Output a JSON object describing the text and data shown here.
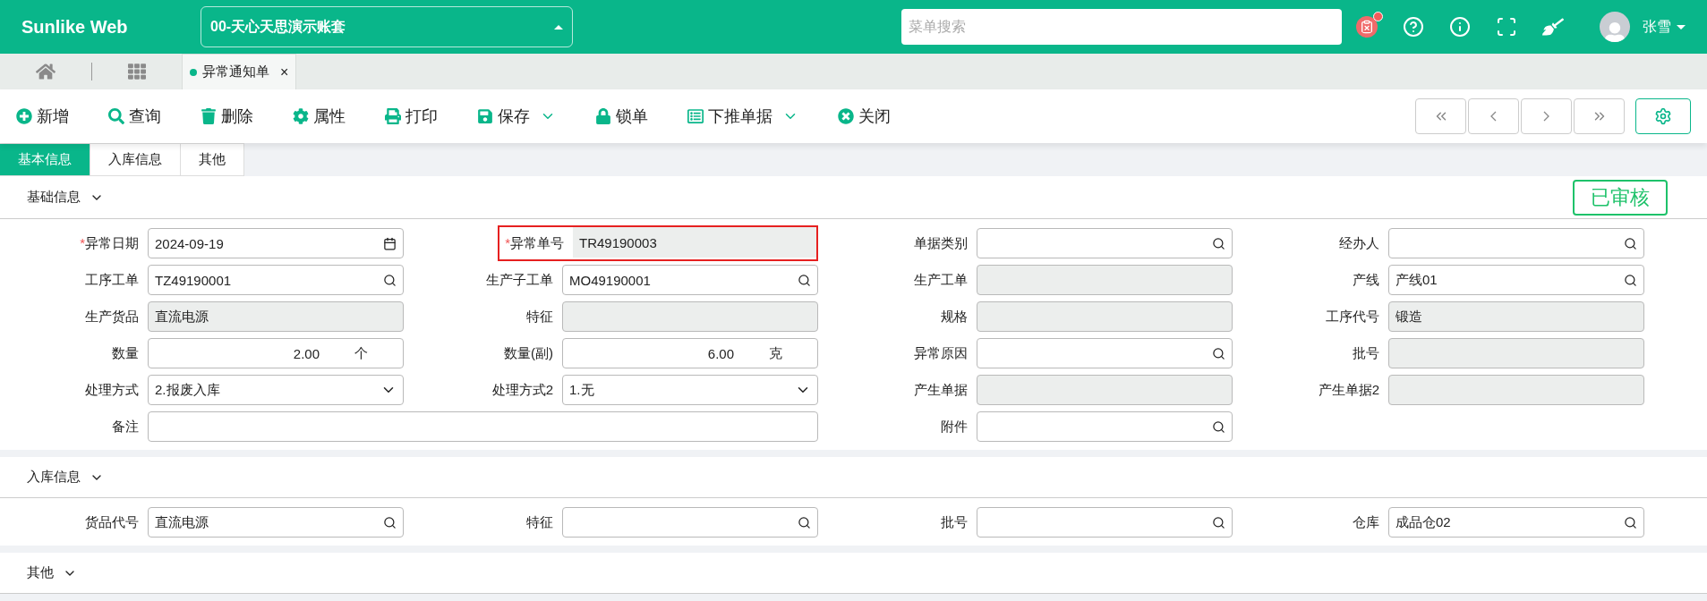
{
  "header": {
    "logo": "Sunlike Web",
    "account": "00-天心天思演示账套",
    "search": {
      "placeholder": "菜单搜索"
    },
    "notification_badge": true,
    "user": "张雪"
  },
  "open_tabs": [
    {
      "label": "异常通知单",
      "selected": true,
      "close": "×"
    }
  ],
  "toolbar": [
    {
      "label": "新增",
      "has_menu": false
    },
    {
      "label": "查询",
      "has_menu": false
    },
    {
      "label": "删除",
      "has_menu": false
    },
    {
      "label": "属性",
      "has_menu": false
    },
    {
      "label": "打印",
      "has_menu": false
    },
    {
      "label": "保存",
      "has_menu": true
    },
    {
      "label": "锁单",
      "has_menu": false
    },
    {
      "label": "下推单据",
      "has_menu": true
    },
    {
      "label": "关闭",
      "has_menu": false
    }
  ],
  "doc_tabs": [
    {
      "label": "基本信息",
      "selected": true
    },
    {
      "label": "入库信息",
      "selected": false
    },
    {
      "label": "其他",
      "selected": false
    }
  ],
  "status_stamp": "已审核",
  "sections": [
    {
      "title": "基础信息",
      "fields": [
        {
          "label": "异常日期",
          "value": "2024-09-19",
          "kind": "date",
          "required_mark": "*",
          "disabled": false
        },
        {
          "label": "异常单号",
          "value": "TR49190003",
          "kind": "text",
          "required_mark": "*",
          "disabled": true,
          "highlighted": true
        },
        {
          "label": "单据类别",
          "kind": "lookup",
          "disabled": false
        },
        {
          "label": "经办人",
          "kind": "lookup",
          "disabled": false
        },
        {
          "label": "工序工单",
          "value": "TZ49190001",
          "kind": "lookup",
          "disabled": false
        },
        {
          "label": "生产子工单",
          "value": "MO49190001",
          "kind": "lookup",
          "disabled": false
        },
        {
          "label": "生产工单",
          "kind": "text",
          "disabled": true
        },
        {
          "label": "产线",
          "value": "产线01",
          "kind": "lookup",
          "disabled": false
        },
        {
          "label": "生产货品",
          "value": "直流电源",
          "kind": "text",
          "disabled": true
        },
        {
          "label": "特征",
          "kind": "text",
          "disabled": true
        },
        {
          "label": "规格",
          "kind": "text",
          "disabled": true
        },
        {
          "label": "工序代号",
          "value": "锻造",
          "kind": "text",
          "disabled": true
        },
        {
          "label": "数量",
          "value": "2.00",
          "unit": "个",
          "kind": "number",
          "disabled": false
        },
        {
          "label": "数量(副)",
          "value": "6.00",
          "unit": "克",
          "kind": "number",
          "disabled": false
        },
        {
          "label": "异常原因",
          "kind": "lookup",
          "disabled": false
        },
        {
          "label": "批号",
          "kind": "text",
          "disabled": true
        },
        {
          "label": "处理方式",
          "value": "2.报废入库",
          "kind": "select",
          "disabled": false
        },
        {
          "label": "处理方式2",
          "value": "1.无",
          "kind": "select",
          "disabled": false
        },
        {
          "label": "产生单据",
          "kind": "text",
          "disabled": true
        },
        {
          "label": "产生单据2",
          "kind": "text",
          "disabled": true
        },
        {
          "label": "备注",
          "kind": "text",
          "disabled": false,
          "wide": true
        },
        {
          "label": "附件",
          "kind": "lookup",
          "disabled": false
        }
      ]
    },
    {
      "title": "入库信息",
      "fields": [
        {
          "label": "货品代号",
          "value": "直流电源",
          "kind": "lookup",
          "disabled": false
        },
        {
          "label": "特征",
          "kind": "lookup",
          "disabled": false
        },
        {
          "label": "批号",
          "kind": "lookup",
          "disabled": false
        },
        {
          "label": "仓库",
          "value": "成品仓02",
          "kind": "lookup",
          "disabled": false
        }
      ]
    },
    {
      "title": "其他"
    }
  ]
}
